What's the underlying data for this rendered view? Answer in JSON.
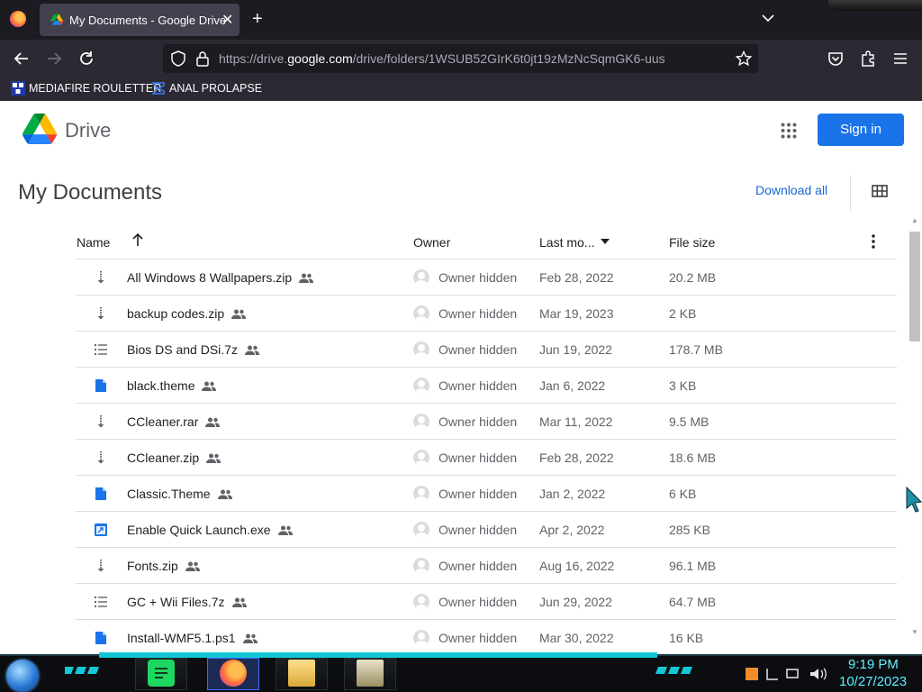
{
  "browser": {
    "tab_title": "My Documents - Google Drive",
    "url_prefix": "https://drive.",
    "url_domain": "google.com",
    "url_path": "/drive/folders/1WSUB52GIrK6t0jt19zMzNcSqmGK6-uus",
    "bookmarks": [
      {
        "label": "MEDIAFIRE ROULETTER"
      },
      {
        "label": "ANAL PROLAPSE"
      }
    ]
  },
  "drive": {
    "brand": "Drive",
    "sign_in": "Sign in",
    "folder_title": "My Documents",
    "download_all": "Download all",
    "columns": {
      "name": "Name",
      "owner": "Owner",
      "modified": "Last mo...",
      "size": "File size"
    },
    "files": [
      {
        "name": "All Windows 8 Wallpapers.zip",
        "type": "archive",
        "owner": "Owner hidden",
        "modified": "Feb 28, 2022",
        "size": "20.2 MB"
      },
      {
        "name": "backup codes.zip",
        "type": "archive",
        "owner": "Owner hidden",
        "modified": "Mar 19, 2023",
        "size": "2 KB"
      },
      {
        "name": "Bios DS and DSi.7z",
        "type": "list",
        "owner": "Owner hidden",
        "modified": "Jun 19, 2022",
        "size": "178.7 MB"
      },
      {
        "name": "black.theme",
        "type": "doc",
        "owner": "Owner hidden",
        "modified": "Jan 6, 2022",
        "size": "3 KB"
      },
      {
        "name": "CCleaner.rar",
        "type": "archive",
        "owner": "Owner hidden",
        "modified": "Mar 11, 2022",
        "size": "9.5 MB"
      },
      {
        "name": "CCleaner.zip",
        "type": "archive",
        "owner": "Owner hidden",
        "modified": "Feb 28, 2022",
        "size": "18.6 MB"
      },
      {
        "name": "Classic.Theme",
        "type": "doc",
        "owner": "Owner hidden",
        "modified": "Jan 2, 2022",
        "size": "6 KB"
      },
      {
        "name": "Enable Quick Launch.exe",
        "type": "exe",
        "owner": "Owner hidden",
        "modified": "Apr 2, 2022",
        "size": "285 KB"
      },
      {
        "name": "Fonts.zip",
        "type": "archive",
        "owner": "Owner hidden",
        "modified": "Aug 16, 2022",
        "size": "96.1 MB"
      },
      {
        "name": "GC + Wii Files.7z",
        "type": "list",
        "owner": "Owner hidden",
        "modified": "Jun 29, 2022",
        "size": "64.7 MB"
      },
      {
        "name": "Install-WMF5.1.ps1",
        "type": "doc",
        "owner": "Owner hidden",
        "modified": "Mar 30, 2022",
        "size": "16 KB"
      }
    ]
  },
  "taskbar": {
    "time": "9:19 PM",
    "date": "10/27/2023"
  },
  "colors": {
    "accent_blue": "#1a73e8",
    "link_blue": "#1967d2",
    "browser_dark": "#1c1b22",
    "clock_cyan": "#5ff0ff"
  },
  "icons": {
    "archive": "zip-archive-icon",
    "list": "list-file-icon",
    "doc": "blue-document-icon",
    "exe": "executable-icon",
    "shared": "shared-people-icon"
  }
}
